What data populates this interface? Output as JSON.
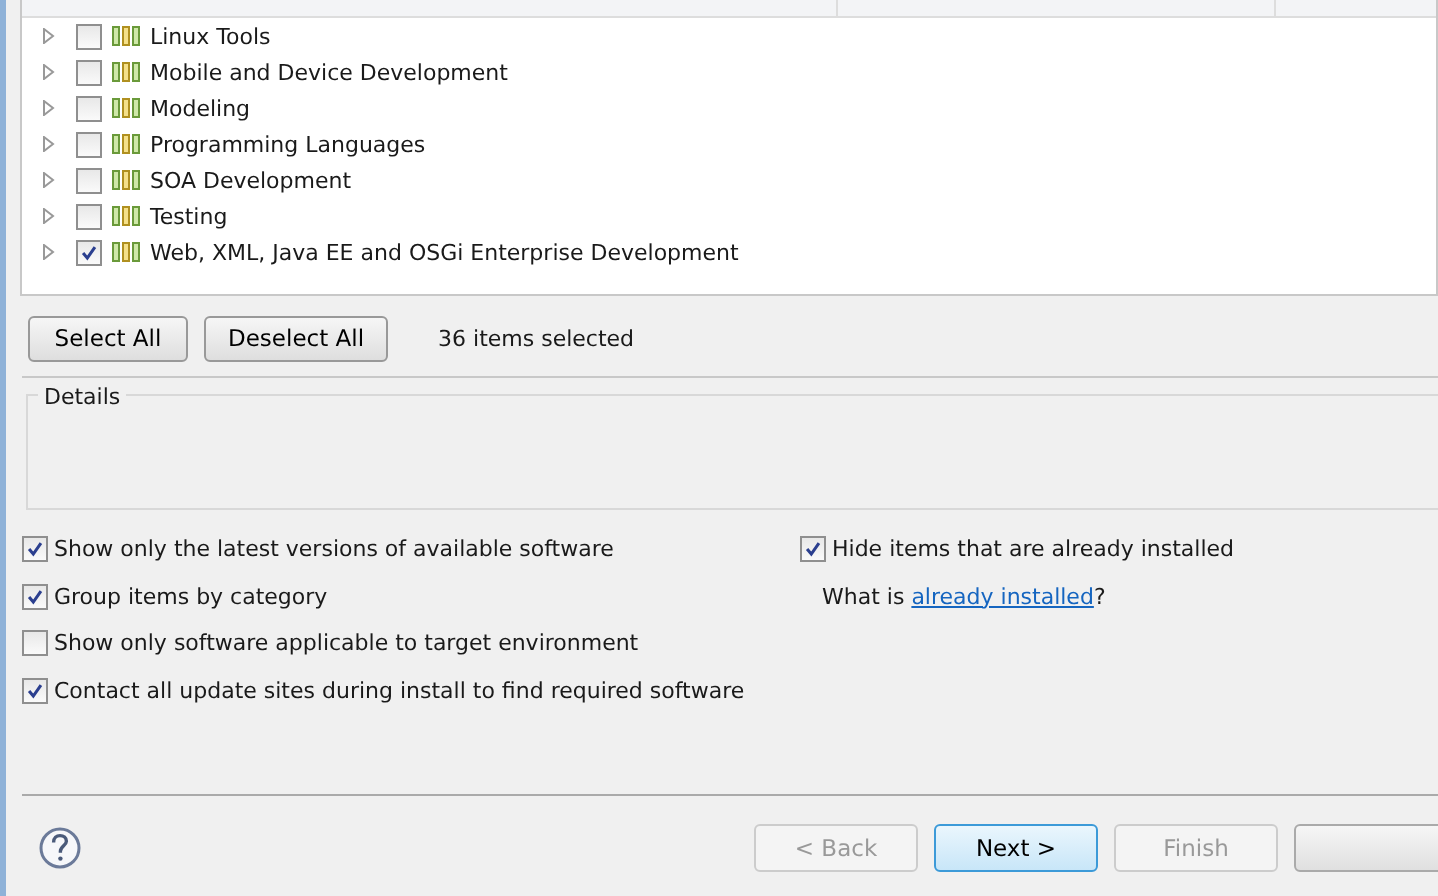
{
  "table": {
    "rows": [
      {
        "label": "Linux Tools",
        "checked": false,
        "expanded": false
      },
      {
        "label": "Mobile and Device Development",
        "checked": false,
        "expanded": false
      },
      {
        "label": "Modeling",
        "checked": false,
        "expanded": false
      },
      {
        "label": "Programming Languages",
        "checked": false,
        "expanded": false
      },
      {
        "label": "SOA Development",
        "checked": false,
        "expanded": false
      },
      {
        "label": "Testing",
        "checked": false,
        "expanded": false
      },
      {
        "label": "Web, XML, Java EE and OSGi Enterprise Development",
        "checked": true,
        "expanded": false
      }
    ]
  },
  "selection_buttons": [
    "Select All",
    "Deselect All"
  ],
  "selection_count": "36 items selected",
  "details": {
    "title": "Details"
  },
  "options_left": [
    {
      "label": "Show only the latest versions of available software",
      "checked": true
    },
    {
      "label": "Group items by category",
      "checked": true
    },
    {
      "label": "Show only software applicable to target environment",
      "checked": false
    },
    {
      "label": "Contact all update sites during install to find required software",
      "checked": true
    }
  ],
  "options_right": {
    "option": {
      "label": "Hide items that are already installed",
      "checked": true
    },
    "prefix": "What is ",
    "link": "already installed",
    "suffix": "?"
  },
  "footer_buttons": [
    {
      "label": "< Back",
      "disabled": true,
      "default": false
    },
    {
      "label": "Next >",
      "disabled": false,
      "default": true
    },
    {
      "label": "Finish",
      "disabled": true,
      "default": false
    },
    {
      "disabled": false,
      "default": false
    }
  ]
}
